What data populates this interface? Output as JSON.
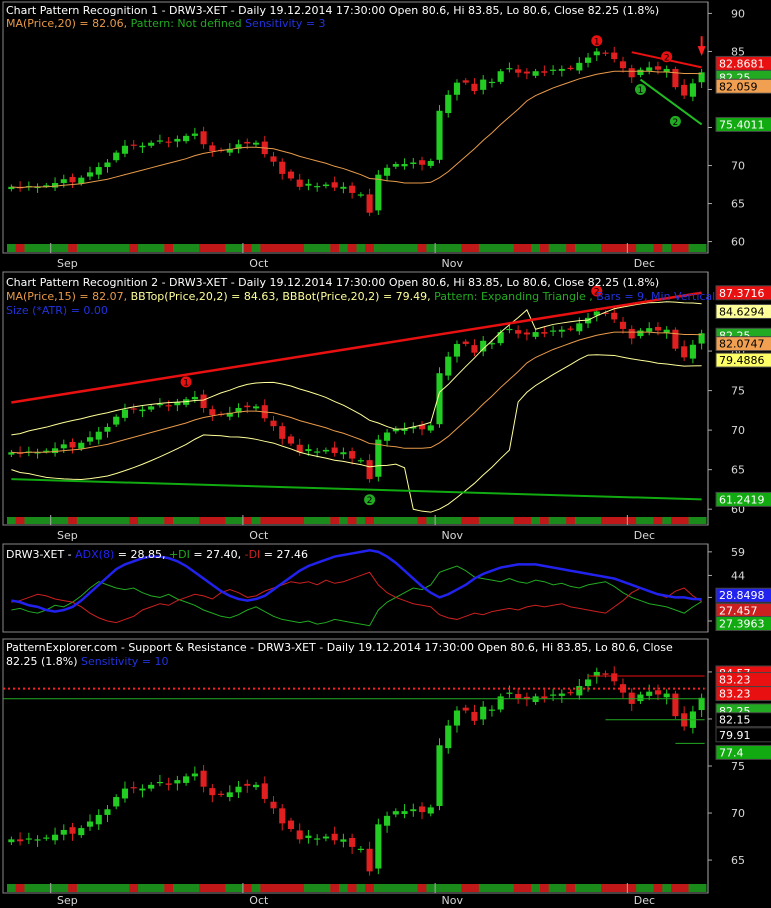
{
  "colors": {
    "bull": "#22cc22",
    "bear": "#e02020",
    "ma": "#e89a4a",
    "bands": "#ffff99",
    "trend_up": "#e81010",
    "trend_dn": "#22aa22",
    "adx": "#2222ee",
    "plus_di": "#22aa22",
    "minus_di": "#cc2020",
    "grid_text": "#d8d8d8",
    "sr_dotted": "#ff2020"
  },
  "xaxis": {
    "labels": [
      "Sep",
      "Oct",
      "Nov",
      "Dec"
    ]
  },
  "panels": [
    {
      "title": "Chart Pattern Recognition 1  - DRW3-XET - Daily 19.12.2014 17:30:00 Open 80.6, Hi 83.85, Lo 80.6, Close 82.25 (1.8%)",
      "legend": [
        {
          "text": "MA(Price,20) = 82.06, ",
          "color": "#e89a4a"
        },
        {
          "text": "Pattern: Not defined ",
          "color": "#22aa22"
        },
        {
          "text": "Sensitivity = 3",
          "color": "#2233dd"
        }
      ],
      "yticks": [
        "90",
        "85",
        "80",
        "75",
        "70",
        "65",
        "60"
      ],
      "price_tags": [
        {
          "text": "82.8681",
          "bg": "#e81010",
          "fg": "#ffffff"
        },
        {
          "text": "82.25",
          "bg": "#22aa22",
          "fg": "#ffffff"
        },
        {
          "text": "82.059",
          "bg": "#f0a050",
          "fg": "#000000"
        },
        {
          "text": "75.4011",
          "bg": "#11aa11",
          "fg": "#ffffff"
        }
      ],
      "markers": [
        {
          "label": "1",
          "color": "#e81010"
        },
        {
          "label": "2",
          "color": "#e81010"
        },
        {
          "label": "1",
          "color": "#22aa22"
        },
        {
          "label": "2",
          "color": "#22aa22"
        }
      ]
    },
    {
      "title": "Chart Pattern Recognition 2  - DRW3-XET - Daily 19.12.2014 17:30:00 Open 80.6, Hi 83.85, Lo 80.6, Close 82.25 (1.8%)",
      "legend": [
        {
          "text": "MA(Price,15) = 82.07, ",
          "color": "#e89a4a"
        },
        {
          "text": "BBTop(Price,20,2) = 84.63, BBBot(Price,20,2) = 79.49, ",
          "color": "#ffff99"
        },
        {
          "text": "Pattern: Expanding Triangle , ",
          "color": "#22aa22"
        },
        {
          "text": "Bars = 9, Min Vertical",
          "color": "#2233dd"
        }
      ],
      "legend2": [
        {
          "text": "Size (*ATR) = 0.00",
          "color": "#2233dd"
        }
      ],
      "yticks": [
        "80",
        "75",
        "70",
        "65",
        "60"
      ],
      "price_tags": [
        {
          "text": "87.3716",
          "bg": "#e81010",
          "fg": "#ffffff"
        },
        {
          "text": "84.6294",
          "bg": "#ffff99",
          "fg": "#000000"
        },
        {
          "text": "82.25",
          "bg": "#22aa22",
          "fg": "#ffffff"
        },
        {
          "text": "82.0747",
          "bg": "#f0a050",
          "fg": "#000000"
        },
        {
          "text": "79.4886",
          "bg": "#ffff66",
          "fg": "#000000"
        },
        {
          "text": "61.2419",
          "bg": "#11aa11",
          "fg": "#ffffff"
        }
      ],
      "markers": [
        {
          "label": "1",
          "color": "#e81010"
        },
        {
          "label": "2",
          "color": "#e81010"
        },
        {
          "label": "2",
          "color": "#22aa22"
        }
      ]
    },
    {
      "title": "DRW3-XET - ",
      "legend": [
        {
          "text": "DRW3-XET - ",
          "color": "#ffffff"
        },
        {
          "text": "ADX(8)",
          "color": "#2222ee"
        },
        {
          "text": " = 28.85, ",
          "color": "#ffffff"
        },
        {
          "text": "+DI",
          "color": "#22aa22"
        },
        {
          "text": " = 27.40, ",
          "color": "#ffffff"
        },
        {
          "text": "-DI",
          "color": "#cc2020"
        },
        {
          "text": " = 27.46",
          "color": "#ffffff"
        }
      ],
      "yticks": [
        "59",
        "44",
        "30",
        "15"
      ],
      "price_tags": [
        {
          "text": "28.8498",
          "bg": "#2222ee",
          "fg": "#ffffff"
        },
        {
          "text": "27.457",
          "bg": "#cc2020",
          "fg": "#ffffff"
        },
        {
          "text": "27.3963",
          "bg": "#11aa11",
          "fg": "#ffffff"
        }
      ]
    },
    {
      "title": "PatternExplorer.com - Support & Resistance  - DRW3-XET - Daily 19.12.2014 17:30:00 Open 80.6, Hi 83.85, Lo 80.6, Close",
      "legend": [
        {
          "text": "82.25 (1.8%)  ",
          "color": "#ffffff"
        },
        {
          "text": "Sensitivity = 10",
          "color": "#2233dd"
        }
      ],
      "yticks": [
        "85",
        "80",
        "75",
        "70",
        "65"
      ],
      "price_tags": [
        {
          "text": "84.57",
          "bg": "#e81010",
          "fg": "#ffffff"
        },
        {
          "text": "83.23",
          "bg": "#e81010",
          "fg": "#ffffff"
        },
        {
          "text": "83.23",
          "bg": "#e81010",
          "fg": "#ffffff"
        },
        {
          "text": "82.25",
          "bg": "#22aa22",
          "fg": "#ffffff"
        },
        {
          "text": "82.15",
          "bg": "#000000",
          "fg": "#ffffff"
        },
        {
          "text": "79.91",
          "bg": "#000000",
          "fg": "#ffffff"
        },
        {
          "text": "77.4",
          "bg": "#11aa11",
          "fg": "#ffffff"
        }
      ]
    }
  ],
  "chart_data": [
    {
      "type": "candlestick",
      "title": "Chart Pattern Recognition 1  - DRW3-XET - Daily 19.12.2014 17:30:00 Open 80.6, Hi 83.85, Lo 80.6, Close 82.25 (1.8%)",
      "ylim": [
        58.5,
        91.5
      ],
      "closes": [
        67.2,
        67.0,
        67.3,
        67.2,
        67.4,
        67.7,
        68.2,
        67.8,
        68.4,
        69.1,
        69.8,
        70.4,
        71.7,
        72.6,
        72.7,
        72.6,
        73.0,
        73.3,
        73.0,
        73.5,
        73.9,
        74.2,
        72.8,
        71.9,
        72.0,
        72.2,
        72.8,
        72.9,
        73.0,
        71.5,
        70.5,
        68.9,
        68.3,
        67.2,
        67.6,
        67.3,
        67.5,
        67.1,
        67.2,
        66.4,
        66.2,
        63.8,
        68.8,
        69.7,
        70.2,
        70.2,
        70.4,
        70.1,
        70.6,
        77.2,
        79.3,
        80.9,
        80.9,
        79.8,
        81.3,
        81.0,
        82.4,
        82.8,
        82.2,
        82.1,
        82.4,
        82.2,
        82.6,
        82.7,
        82.8,
        83.5,
        84.2,
        85.0,
        84.7,
        84.0,
        82.8,
        81.6,
        82.6,
        82.9,
        82.6,
        82.7,
        80.3,
        79.2,
        80.8,
        82.25
      ],
      "ma": {
        "name": "MA(Price,20)",
        "values": [
          67.2,
          67.1,
          67.2,
          67.2,
          67.2,
          67.3,
          67.4,
          67.5,
          67.6,
          67.8,
          68.0,
          68.2,
          68.5,
          68.8,
          69.1,
          69.4,
          69.7,
          70.0,
          70.3,
          70.6,
          70.9,
          71.3,
          71.6,
          71.8,
          72.0,
          72.1,
          72.3,
          72.4,
          72.4,
          72.3,
          72.2,
          71.9,
          71.6,
          71.2,
          70.9,
          70.6,
          70.3,
          69.9,
          69.6,
          69.2,
          68.8,
          68.3,
          68.2,
          68.0,
          67.9,
          67.7,
          67.7,
          67.7,
          67.8,
          68.4,
          69.2,
          70.2,
          71.2,
          72.2,
          73.3,
          74.3,
          75.4,
          76.4,
          77.4,
          78.5,
          79.2,
          79.7,
          80.2,
          80.6,
          81.0,
          81.4,
          81.7,
          82.0,
          82.2,
          82.4,
          82.4,
          82.4,
          82.4,
          82.4,
          82.3,
          82.3,
          82.2,
          82.1,
          82.1,
          82.06
        ]
      },
      "trendlines": [
        {
          "name": "resistance",
          "from": [
            71,
            84.9
          ],
          "to": [
            79,
            82.9
          ]
        },
        {
          "name": "support",
          "from": [
            72,
            81.3
          ],
          "to": [
            79,
            75.4
          ]
        }
      ],
      "annotations": [
        "82.8681",
        "82.25",
        "82.059",
        "75.4011"
      ]
    },
    {
      "type": "candlestick",
      "title": "Chart Pattern Recognition 2  - DRW3-XET - Daily 19.12.2014 17:30:00 Open 80.6, Hi 83.85, Lo 80.6, Close 82.25 (1.8%)",
      "ylim": [
        58.0,
        90.0
      ],
      "bb_top_last": 84.63,
      "bb_bot_last": 79.49,
      "ma15_last": 82.07,
      "trendlines": [
        {
          "name": "upper",
          "from": [
            0,
            73.5
          ],
          "to": [
            79,
            87.37
          ]
        },
        {
          "name": "lower",
          "from": [
            0,
            63.8
          ],
          "to": [
            79,
            61.24
          ]
        }
      ],
      "pattern": "Expanding Triangle",
      "bars": 9
    },
    {
      "type": "line",
      "title": "DRW3-XET - ADX(8) = 28.85, +DI = 27.40, -DI = 27.46",
      "ylim": [
        8,
        64
      ],
      "series": [
        {
          "name": "ADX(8)",
          "values": [
            28,
            27,
            25,
            24,
            22,
            21,
            22,
            24,
            28,
            33,
            38,
            43,
            48,
            51,
            53,
            55,
            56,
            56,
            55,
            53,
            50,
            46,
            42,
            38,
            34,
            31,
            29,
            28,
            29,
            31,
            35,
            39,
            43,
            47,
            50,
            52,
            54,
            56,
            57,
            58,
            59,
            60,
            59,
            56,
            52,
            47,
            42,
            37,
            33,
            30,
            32,
            35,
            38,
            42,
            45,
            47,
            49,
            50,
            51,
            51,
            51,
            50,
            49,
            48,
            47,
            46,
            45,
            44,
            43,
            42,
            40,
            38,
            36,
            34,
            32,
            31,
            30,
            30,
            29,
            28.85
          ]
        },
        {
          "name": "+DI",
          "values": [
            22,
            23,
            21,
            20,
            22,
            25,
            24,
            27,
            31,
            36,
            40,
            38,
            36,
            35,
            36,
            33,
            31,
            30,
            32,
            29,
            27,
            25,
            22,
            20,
            18,
            17,
            19,
            22,
            24,
            21,
            18,
            16,
            15,
            14,
            15,
            13,
            14,
            16,
            15,
            14,
            13,
            12,
            22,
            27,
            30,
            33,
            36,
            35,
            38,
            46,
            48,
            50,
            47,
            43,
            42,
            41,
            40,
            42,
            40,
            39,
            41,
            40,
            38,
            39,
            37,
            36,
            38,
            39,
            40,
            37,
            33,
            30,
            28,
            26,
            25,
            24,
            22,
            20,
            24,
            27.4
          ]
        },
        {
          "name": "-DI",
          "values": [
            27,
            28,
            30,
            32,
            31,
            29,
            28,
            27,
            24,
            20,
            17,
            15,
            14,
            16,
            18,
            22,
            24,
            26,
            25,
            28,
            30,
            32,
            31,
            29,
            33,
            35,
            33,
            30,
            31,
            34,
            36,
            38,
            40,
            39,
            40,
            38,
            41,
            39,
            40,
            42,
            44,
            46,
            38,
            33,
            30,
            28,
            26,
            25,
            24,
            19,
            17,
            16,
            18,
            20,
            19,
            21,
            22,
            23,
            22,
            24,
            25,
            24,
            25,
            26,
            24,
            23,
            22,
            21,
            20,
            24,
            28,
            33,
            36,
            34,
            32,
            30,
            34,
            36,
            31,
            27.46
          ]
        }
      ]
    },
    {
      "type": "candlestick",
      "title": "PatternExplorer.com - Support & Resistance  - DRW3-XET - Daily 19.12.2014 17:30:00 Open 80.6, Hi 83.85, Lo 80.6, Close",
      "ylim": [
        61.5,
        88.5
      ],
      "levels": [
        84.57,
        83.23,
        82.15,
        79.91,
        77.4
      ]
    }
  ]
}
